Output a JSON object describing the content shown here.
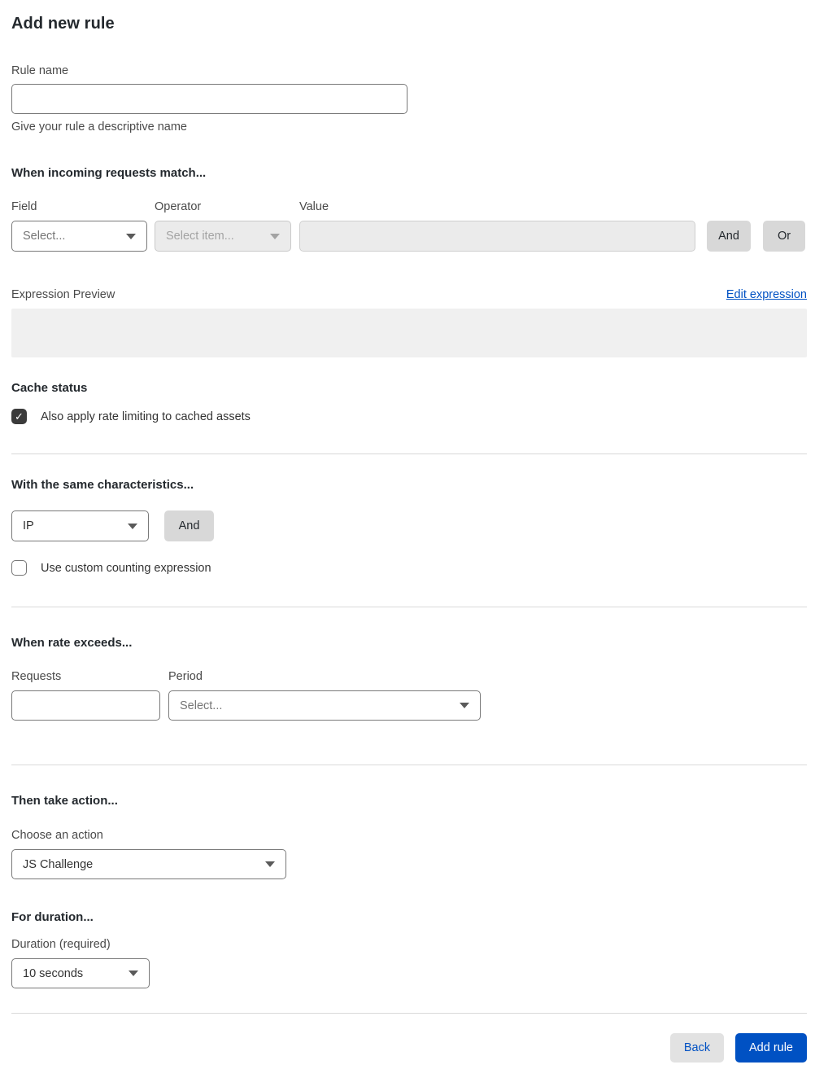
{
  "page": {
    "title": "Add new rule"
  },
  "colors": {
    "accent_blue": "#0051c3",
    "gray_button": "#d8d8d8",
    "disabled_bg": "#ebebeb",
    "preview_bg": "#f0f0f0",
    "checkbox_checked": "#3b3b3b",
    "divider": "#d9d9d9"
  },
  "rule_name": {
    "label": "Rule name",
    "value": "",
    "helper": "Give your rule a descriptive name"
  },
  "match_section": {
    "heading": "When incoming requests match...",
    "field": {
      "label": "Field",
      "selected": "Select..."
    },
    "operator": {
      "label": "Operator",
      "selected": "Select item...",
      "disabled": true
    },
    "value": {
      "label": "Value",
      "value": "",
      "disabled": true
    },
    "and_button": "And",
    "or_button": "Or"
  },
  "expression": {
    "label": "Expression Preview",
    "edit_link": "Edit expression",
    "preview_text": ""
  },
  "cache_status": {
    "heading": "Cache status",
    "checkbox_label": "Also apply rate limiting to cached assets",
    "checked": true
  },
  "characteristics": {
    "heading": "With the same characteristics...",
    "select_selected": "IP",
    "and_button": "And",
    "checkbox_label": "Use custom counting expression",
    "checked": false
  },
  "rate_section": {
    "heading": "When rate exceeds...",
    "requests": {
      "label": "Requests",
      "value": ""
    },
    "period": {
      "label": "Period",
      "selected": "Select..."
    }
  },
  "action_section": {
    "heading": "Then take action...",
    "label": "Choose an action",
    "selected": "JS Challenge"
  },
  "duration_section": {
    "heading": "For duration...",
    "label": "Duration (required)",
    "selected": "10 seconds"
  },
  "footer": {
    "back_button": "Back",
    "add_rule_button": "Add rule"
  },
  "icons": {
    "chevron_down": "caret-triangle",
    "check": "✓"
  }
}
